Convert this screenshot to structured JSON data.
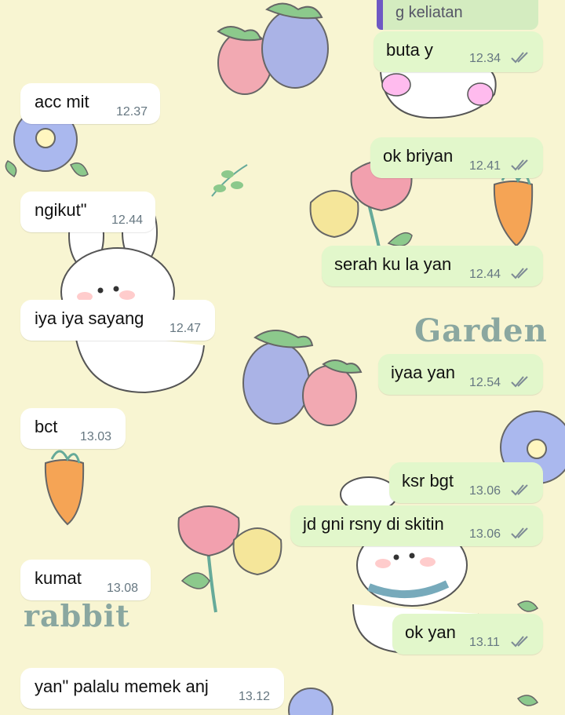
{
  "wallpaper": {
    "word_1": "Garden",
    "word_2": "rabbit",
    "bg_color": "#f8f5d2"
  },
  "quoted_reply": {
    "text": "g keliatan"
  },
  "messages": [
    {
      "dir": "out",
      "text": "buta y",
      "time": "12.34",
      "read": true
    },
    {
      "dir": "in",
      "text": "acc mit",
      "time": "12.37"
    },
    {
      "dir": "out",
      "text": "ok briyan",
      "time": "12.41",
      "read": true
    },
    {
      "dir": "in",
      "text": "ngikut\"",
      "time": "12.44"
    },
    {
      "dir": "out",
      "text": "serah ku la yan",
      "time": "12.44",
      "read": true
    },
    {
      "dir": "in",
      "text": "iya iya sayang",
      "time": "12.47"
    },
    {
      "dir": "out",
      "text": "iyaa yan",
      "time": "12.54",
      "read": true
    },
    {
      "dir": "in",
      "text": "bct",
      "time": "13.03"
    },
    {
      "dir": "out",
      "text": "ksr bgt",
      "time": "13.06",
      "read": true
    },
    {
      "dir": "out",
      "text": "jd gni rsny di skitin",
      "time": "13.06",
      "read": true
    },
    {
      "dir": "in",
      "text": "kumat",
      "time": "13.08"
    },
    {
      "dir": "out",
      "text": "ok yan",
      "time": "13.11",
      "read": true
    },
    {
      "dir": "in",
      "text": "yan\" palalu memek anj",
      "time": "13.12"
    }
  ],
  "colors": {
    "incoming_bubble": "#ffffff",
    "outgoing_bubble": "#e2f7cb",
    "time_text": "#667781",
    "quote_accent": "#6e58c4"
  }
}
